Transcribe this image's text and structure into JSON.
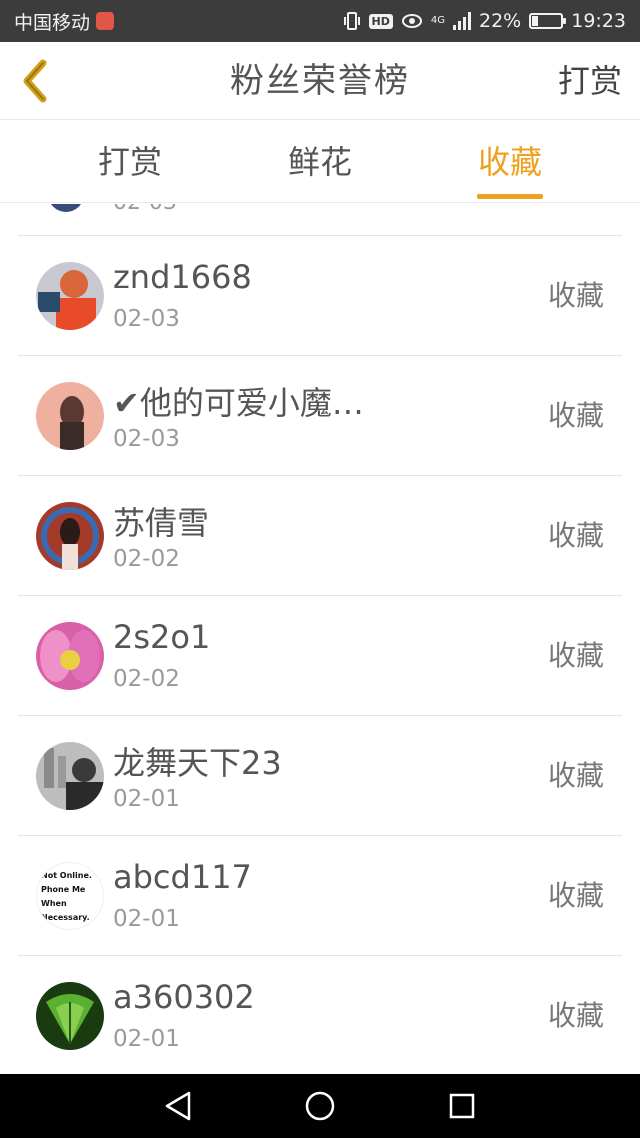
{
  "status_bar": {
    "carrier": "中国移动",
    "hd": "HD",
    "network": "4G",
    "battery_text": "22%",
    "battery_level": 0.22,
    "time": "19:23"
  },
  "header": {
    "back_icon": "chevron-left-icon",
    "title": "粉丝荣誉榜",
    "action": "打赏"
  },
  "tabs": [
    {
      "label": "打赏",
      "active": false
    },
    {
      "label": "鲜花",
      "active": false
    },
    {
      "label": "收藏",
      "active": true
    }
  ],
  "accent_color": "#f0a020",
  "list": {
    "partial_date": "02-03",
    "rows": [
      {
        "name": "znd1668",
        "date": "02-03",
        "action": "收藏",
        "avatar_color": "#d8663a"
      },
      {
        "name": "✔他的可爱小魔…",
        "date": "02-03",
        "action": "收藏",
        "avatar_color": "#e8a090"
      },
      {
        "name": "苏倩雪",
        "date": "02-02",
        "action": "收藏",
        "avatar_color": "#a33a2a"
      },
      {
        "name": "2s2o1",
        "date": "02-02",
        "action": "收藏",
        "avatar_color": "#e070b0"
      },
      {
        "name": "龙舞天下23",
        "date": "02-01",
        "action": "收藏",
        "avatar_color": "#8a8a8a"
      },
      {
        "name": "abcd117",
        "date": "02-01",
        "action": "收藏",
        "avatar_text": "Not Online. Phone Me When Necessary."
      },
      {
        "name": "a360302",
        "date": "02-01",
        "action": "收藏",
        "avatar_color": "#3c8a2a"
      }
    ]
  },
  "navbar": {
    "back": "triangle-back-icon",
    "home": "circle-home-icon",
    "recents": "square-recents-icon"
  }
}
